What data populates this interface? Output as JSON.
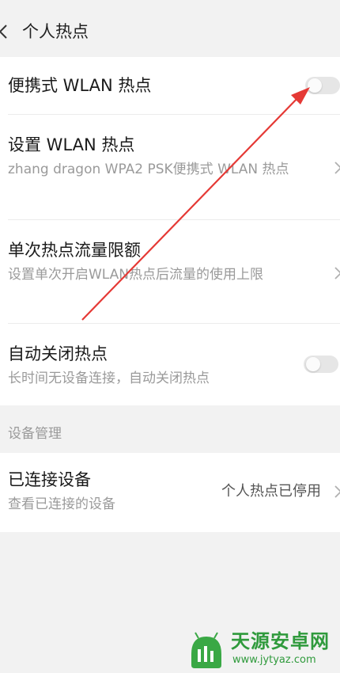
{
  "header": {
    "title": "个人热点"
  },
  "items": [
    {
      "title": "便携式 WLAN 热点",
      "subtitle": "",
      "toggle_on": false
    },
    {
      "title": "设置 WLAN 热点",
      "subtitle": "zhang dragon WPA2 PSK便携式 WLAN 热点"
    },
    {
      "title": "单次热点流量限额",
      "subtitle": "设置单次开启WLAN热点后流量的使用上限"
    },
    {
      "title": "自动关闭热点",
      "subtitle": "长时间无设备连接，自动关闭热点",
      "toggle_on": false
    }
  ],
  "device_section": {
    "label": "设备管理",
    "item": {
      "title": "已连接设备",
      "subtitle": "查看已连接的设备",
      "status": "个人热点已停用"
    }
  },
  "watermark": {
    "text": "天源安卓网",
    "url": "www.jytyaz.com"
  },
  "colors": {
    "annotation_arrow": "#e53935",
    "watermark": "#2f9a3c"
  },
  "icons": [
    "back-arrow-icon",
    "chevron-right-icon",
    "toggle-switch",
    "watermark-logo-icon"
  ]
}
